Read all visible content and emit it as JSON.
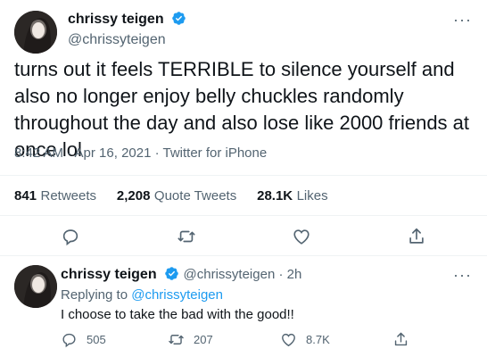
{
  "main_tweet": {
    "name": "chrissy teigen",
    "handle": "@chrissyteigen",
    "more": "···",
    "text": "turns out it feels TERRIBLE to silence yourself and also no longer enjoy belly chuckles randomly throughout the day and also lose like 2000 friends at once lol",
    "meta": "8:42 AM · Apr 16, 2021 · Twitter for iPhone",
    "stats": {
      "retweets_count": "841",
      "retweets_label": "Retweets",
      "quotes_count": "2,208",
      "quotes_label": "Quote Tweets",
      "likes_count": "28.1K",
      "likes_label": "Likes"
    }
  },
  "reply_tweet": {
    "name": "chrissy teigen",
    "handle_time": "@chrissyteigen · 2h",
    "more": "···",
    "replying_prefix": "Replying to",
    "replying_handle": "@chrissyteigen",
    "text": "I choose to take the bad with the good!!",
    "counts": {
      "replies": "505",
      "retweets": "207",
      "likes": "8.7K"
    }
  },
  "colors": {
    "verified": "#1d9bf0",
    "muted": "#536471",
    "divider": "#eff3f4"
  },
  "icons": [
    "verified-badge-icon",
    "reply-icon",
    "retweet-icon",
    "like-icon",
    "share-icon",
    "more-icon"
  ]
}
